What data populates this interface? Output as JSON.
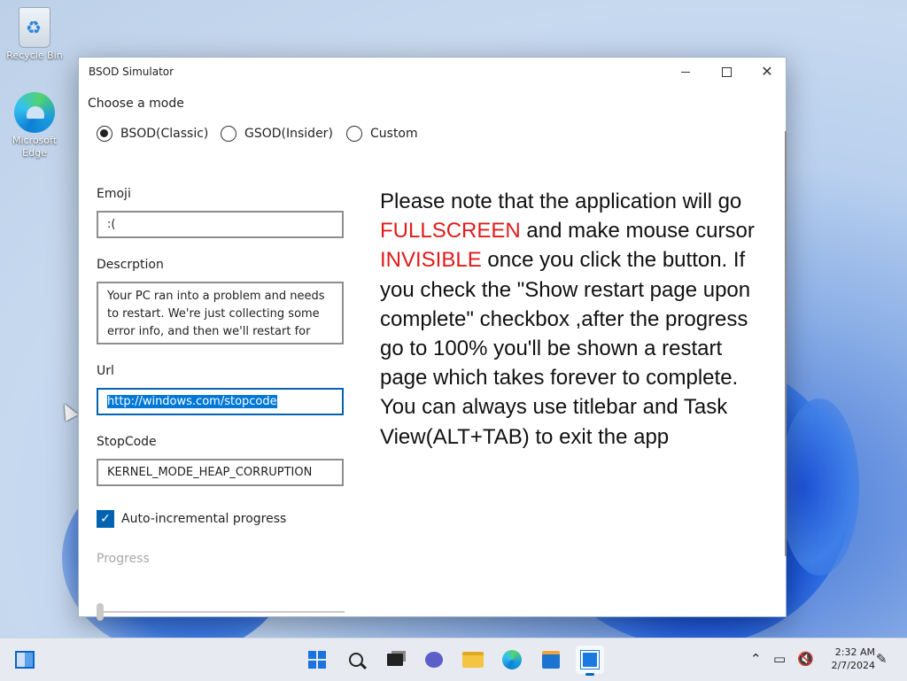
{
  "desktop": {
    "icons": [
      {
        "label": "Recycle Bin"
      },
      {
        "label": "Microsoft Edge"
      }
    ]
  },
  "window": {
    "title": "BSOD Simulator",
    "mode_heading": "Choose a mode",
    "modes": [
      {
        "label": "BSOD(Classic)",
        "selected": true
      },
      {
        "label": "GSOD(Insider)",
        "selected": false
      },
      {
        "label": "Custom",
        "selected": false
      }
    ],
    "emoji": {
      "label": "Emoji",
      "value": ":("
    },
    "description": {
      "label": "Descrption",
      "value": "Your PC ran into a problem and needs to restart. We're just collecting some error info, and then we'll restart for you"
    },
    "url": {
      "label": "Url",
      "value": "http://windows.com/stopcode"
    },
    "stopcode": {
      "label": "StopCode",
      "value": "KERNEL_MODE_HEAP_CORRUPTION"
    },
    "auto_progress": {
      "label": "Auto-incremental progress",
      "checked": true
    },
    "progress": {
      "label": "Progress",
      "value": 0
    },
    "notice": {
      "part1": "Please note that the application will go ",
      "fullscreen": "FULLSCREEN",
      "part2": " and make mouse cursor ",
      "invisible": "INVISIBLE",
      "part3": " once you click the button. If you check the \"Show restart page upon complete\" checkbox ,after the progress go to 100% you'll be shown a restart page which takes forever to complete. You can always use titlebar and Task View(ALT+TAB) to exit the app"
    },
    "accent_color": "#e11b1b"
  },
  "taskbar": {
    "apps": [
      "widgets",
      "start",
      "search",
      "task-view",
      "chat",
      "file-explorer",
      "edge",
      "store",
      "bsod-simulator"
    ],
    "clock": {
      "time": "2:32 AM",
      "date": "2/7/2024"
    }
  }
}
